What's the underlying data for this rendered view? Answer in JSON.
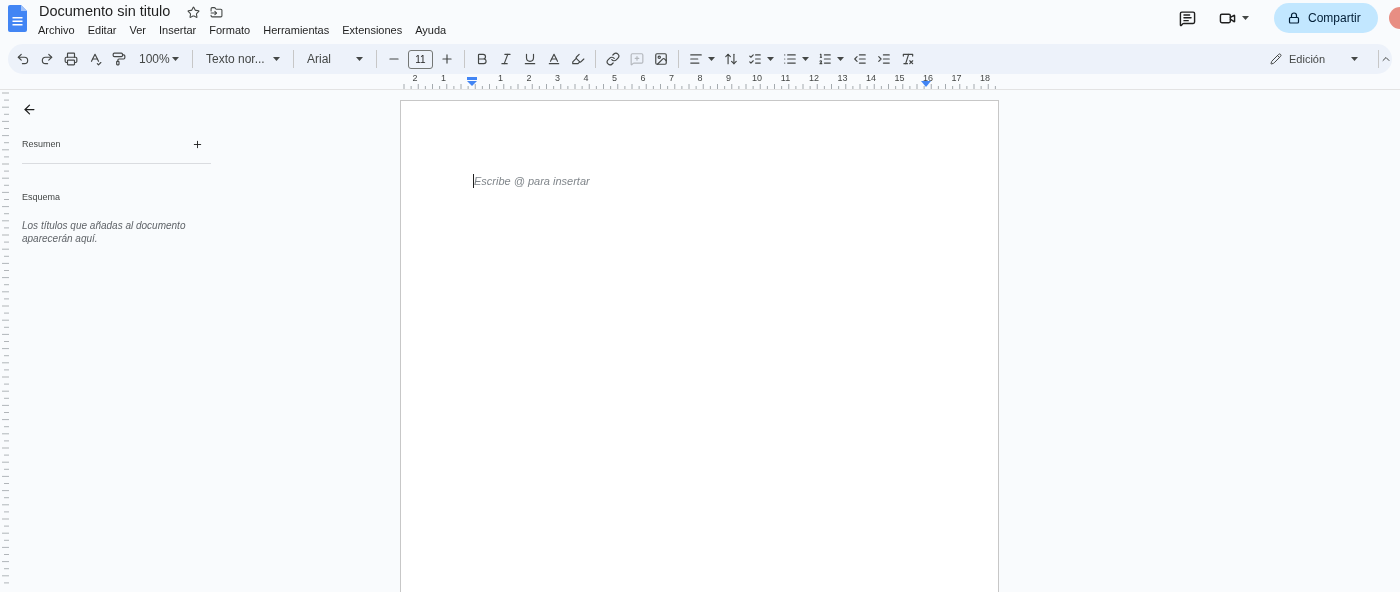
{
  "document": {
    "title": "Documento sin titulo",
    "starred": false
  },
  "menu": [
    "Archivo",
    "Editar",
    "Ver",
    "Insertar",
    "Formato",
    "Herramientas",
    "Extensiones",
    "Ayuda"
  ],
  "share_button": {
    "label": "Compartir"
  },
  "toolbar": [
    {
      "kind": "icon",
      "disabled": false
    },
    {
      "kind": "icon",
      "disabled": false
    },
    {
      "kind": "icon",
      "disabled": false
    },
    {
      "kind": "icon",
      "disabled": false
    },
    {
      "kind": "icon",
      "disabled": false
    },
    {
      "kind": "dropdown",
      "label": "100%"
    },
    {
      "kind": "separator"
    },
    {
      "kind": "dropdown",
      "label": "Texto nor..."
    },
    {
      "kind": "separator"
    },
    {
      "kind": "dropdown",
      "label": "Arial"
    },
    {
      "kind": "separator"
    },
    {
      "kind": "icon",
      "disabled": false
    },
    {
      "kind": "size",
      "label": "11"
    },
    {
      "kind": "icon",
      "disabled": false
    },
    {
      "kind": "separator"
    },
    {
      "kind": "icon",
      "disabled": false
    },
    {
      "kind": "icon",
      "disabled": false
    },
    {
      "kind": "icon",
      "disabled": false
    },
    {
      "kind": "icon",
      "disabled": false
    },
    {
      "kind": "icon",
      "disabled": false
    },
    {
      "kind": "separator"
    },
    {
      "kind": "icon",
      "disabled": false
    },
    {
      "kind": "icon",
      "disabled": true
    },
    {
      "kind": "icon",
      "disabled": false
    },
    {
      "kind": "separator"
    },
    {
      "kind": "icon_menu",
      "disabled": false
    },
    {
      "kind": "icon",
      "disabled": false
    },
    {
      "kind": "icon_menu",
      "disabled": false
    },
    {
      "kind": "icon_menu",
      "disabled": false
    },
    {
      "kind": "icon_menu",
      "disabled": false
    },
    {
      "kind": "icon",
      "disabled": false
    },
    {
      "kind": "icon",
      "disabled": false
    },
    {
      "kind": "icon",
      "disabled": false
    }
  ],
  "mode_button": {
    "label": "Edición"
  },
  "ruler": {
    "left_labels": [
      "2",
      "1"
    ],
    "right_labels": [
      "1",
      "2",
      "3",
      "4",
      "5",
      "6",
      "7",
      "8",
      "9",
      "10",
      "11",
      "12",
      "13",
      "14",
      "15",
      "16",
      "17",
      "18"
    ]
  },
  "sidebar": {
    "summary_label": "Resumen",
    "outline_label": "Esquema",
    "outline_empty": "Los títulos que añadas al documento aparecerán aquí."
  },
  "page": {
    "placeholder": "Escribe @ para insertar"
  }
}
